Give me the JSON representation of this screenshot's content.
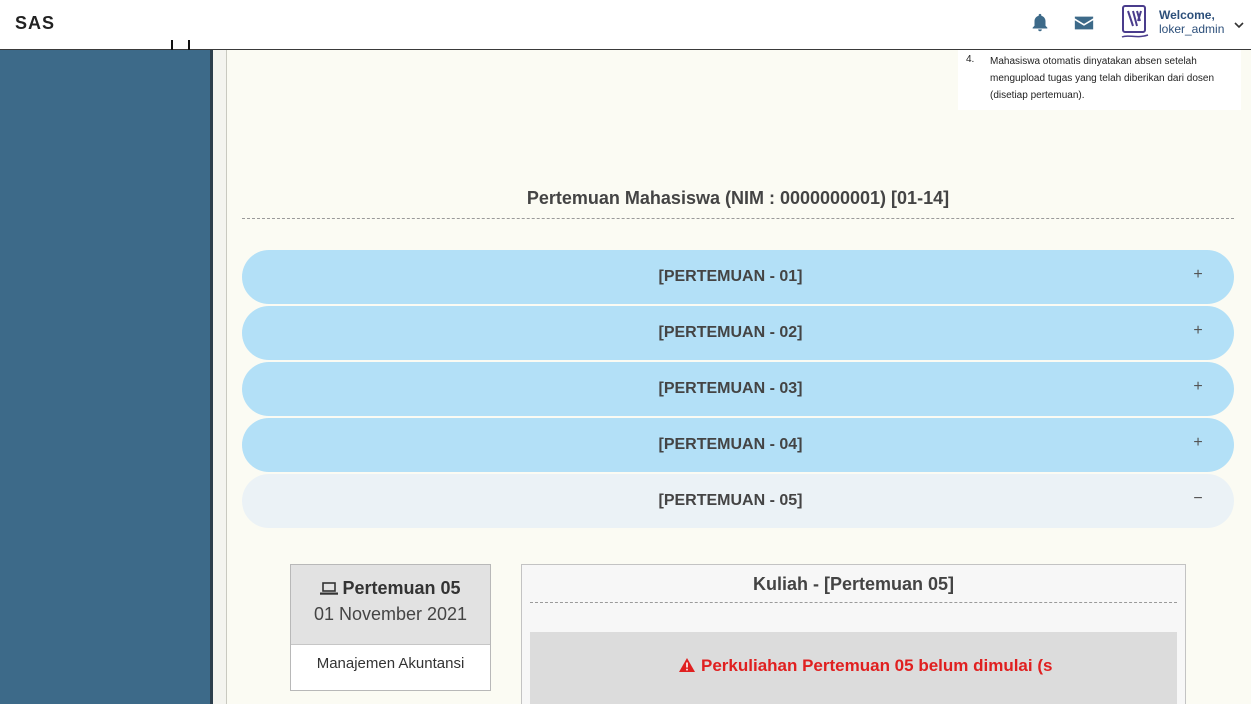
{
  "brand": "SAS",
  "user": {
    "welcome": "Welcome,",
    "username": "loker_admin"
  },
  "icons": {
    "bell": "bell-icon",
    "mail": "envelope-icon",
    "avatar": "logo-avatar",
    "chevron": "chevron-down-icon"
  },
  "notes": {
    "number": "4.",
    "text": "Mahasiswa otomatis dinyatakan absen setelah mengupload tugas yang telah diberikan dari dosen (disetiap pertemuan)."
  },
  "section_title": "Pertemuan Mahasiswa (NIM : 0000000001) [01-14]",
  "meetings": [
    {
      "label": "[PERTEMUAN - 01]",
      "sign": "+"
    },
    {
      "label": "[PERTEMUAN - 02]",
      "sign": "+"
    },
    {
      "label": "[PERTEMUAN - 03]",
      "sign": "+"
    },
    {
      "label": "[PERTEMUAN - 04]",
      "sign": "+"
    },
    {
      "label": "[PERTEMUAN - 05]",
      "sign": "−"
    }
  ],
  "card": {
    "title": "Pertemuan 05",
    "date": "01 November 2021",
    "subject": "Manajemen Akuntansi"
  },
  "panel": {
    "title": "Kuliah - [Pertemuan 05]",
    "alert": "Perkuliahan Pertemuan 05 belum dimulai (s"
  },
  "colors": {
    "sidebar": "#3d6a89",
    "accordion": "#b3e0f7",
    "accordion_open": "#ebf2f6",
    "alert_text": "#e02020",
    "user_text": "#2c4f7a"
  }
}
